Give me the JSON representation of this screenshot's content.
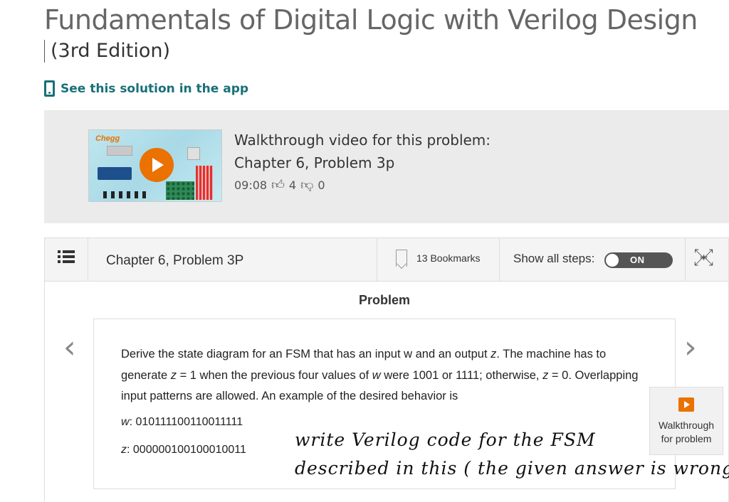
{
  "book": {
    "title": "Fundamentals of Digital Logic with Verilog Design",
    "edition": "(3rd Edition)"
  },
  "app_link": {
    "label": "See this solution in the app"
  },
  "video": {
    "thumb_brand": "Chegg",
    "heading": "Walkthrough video for this problem:",
    "chapter": "Chapter 6, Problem 3p",
    "duration": "09:08",
    "likes": "4",
    "dislikes": "0"
  },
  "solution": {
    "title": "Chapter 6, Problem 3P",
    "bookmarks": "13 Bookmarks",
    "show_steps_label": "Show all steps:",
    "toggle_state": "ON",
    "section_label": "Problem",
    "problem": {
      "part1": "Derive the state diagram for an FSM that has an input w and an output ",
      "z1": "z",
      "part2": ". The machine has to generate ",
      "z2": "z",
      "part3": " = 1 when the previous four values of ",
      "w1": "w",
      "part4": "  were 1001 or 1111; otherwise, ",
      "z3": "z",
      "part5": " = 0. Overlapping input patterns are allowed. An example of the desired behavior is",
      "w_label": "w",
      "w_seq": ": 010111100110011111",
      "z_label": "z",
      "z_seq": ": 000000100100010011"
    },
    "handwritten_note_line1": "write  Verilog  code  for the  FSM",
    "handwritten_note_line2": "described  in this  ( the  given  answer is  wrong)"
  },
  "walkthrough_button": {
    "label_line1": "Walkthrough",
    "label_line2": "for problem"
  },
  "nav": {
    "prev_glyph": "‹",
    "next_glyph": "›"
  }
}
